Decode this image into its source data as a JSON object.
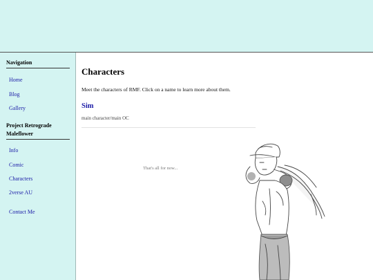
{
  "sidebar": {
    "navigation_heading": "Navigation",
    "nav_links": [
      "Home",
      "Blog",
      "Gallery"
    ],
    "project_heading_line1": "Project Retrograde",
    "project_heading_line2": "Maleflower",
    "project_links": [
      "Info",
      "Comic",
      "Characters",
      "2verse AU"
    ],
    "contact_link": "Contact Me"
  },
  "main": {
    "title": "Characters",
    "intro": "Meet the characters of RMF. Click on a name to learn more about them.",
    "characters": [
      {
        "name": "Sim",
        "description": "main character/main OC"
      }
    ],
    "footer_note": "That's all for now..."
  },
  "colors": {
    "panel_bg": "#d4f4f2",
    "link": "#1a1aa6"
  },
  "icons": [
    "character-illustration"
  ]
}
